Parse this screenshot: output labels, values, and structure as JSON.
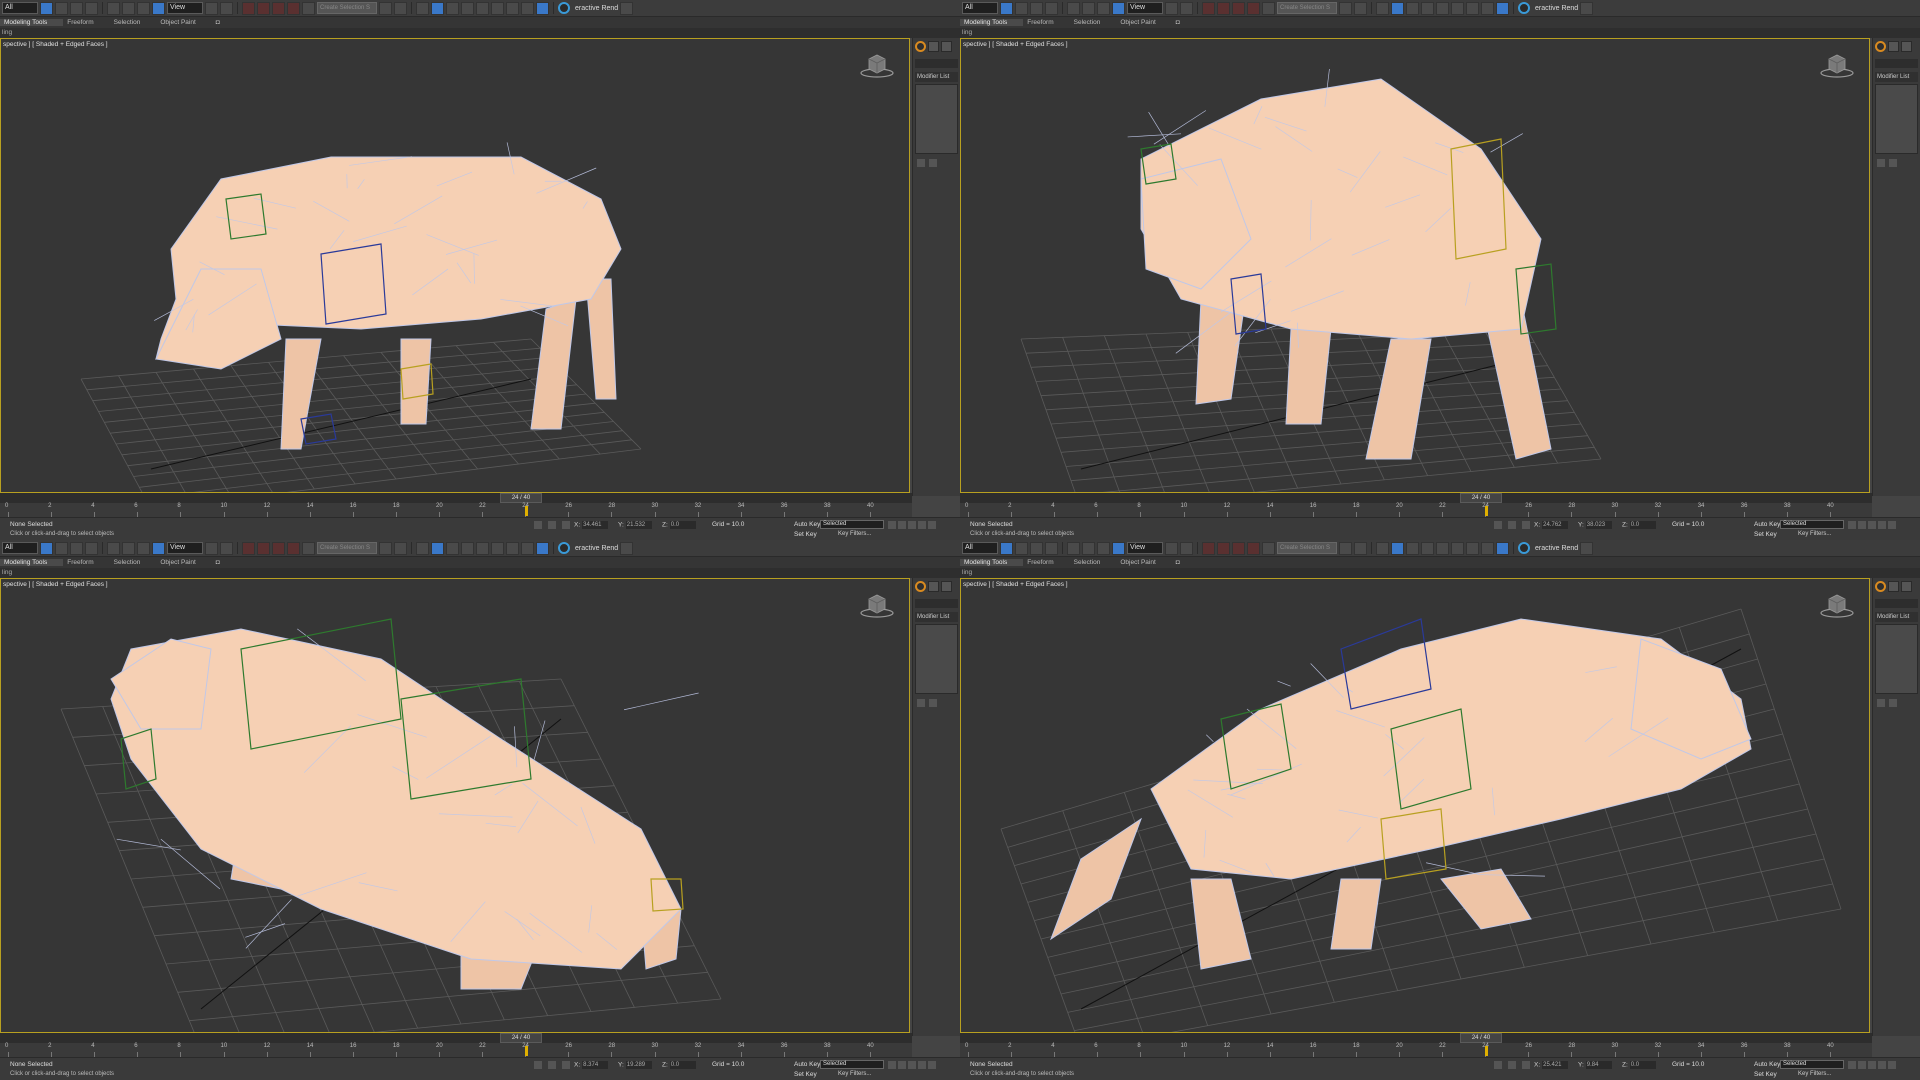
{
  "toolbar": {
    "selection_filter": "All",
    "view_dropdown": "View",
    "named_selection_placeholder": "Create Selection S",
    "render_label": "eractive Rend"
  },
  "ribbon": {
    "tabs": [
      "Modeling Tools",
      "Freeform",
      "Selection",
      "Object Paint"
    ],
    "subtitles": [
      "ling",
      "ling",
      "ling",
      "ling"
    ]
  },
  "viewport": {
    "label": "spective ] [ Shaded + Edged Faces ]"
  },
  "command_panel": {
    "modifier_list": "Modifier List"
  },
  "timeline": {
    "frame_indicator": "24 / 40",
    "ticks": [
      "0",
      "2",
      "4",
      "6",
      "8",
      "10",
      "12",
      "14",
      "16",
      "18",
      "20",
      "22",
      "24",
      "26",
      "28",
      "30",
      "32",
      "34",
      "36",
      "38",
      "40"
    ],
    "current_frame": 24,
    "total_frames": 40
  },
  "status": {
    "selection": "None Selected",
    "x_label": "X:",
    "y_label": "Y:",
    "z_label": "Z:",
    "grid": "Grid = 10.0",
    "auto_key": "Auto Key",
    "set_key": "Set Key",
    "key_mode": "Selected",
    "key_filters": "Key Filters...",
    "hint": "Click or click-and-drag to select objects"
  },
  "quadrants": [
    {
      "x": "34.461",
      "y": "21.532",
      "z": "0.0"
    },
    {
      "x": "24.762",
      "y": "38.023",
      "z": "0.0"
    },
    {
      "x": "8.374",
      "y": "19.289",
      "z": "0.0"
    },
    {
      "x": "25.421",
      "y": "9.84",
      "z": "0.0"
    }
  ],
  "colors": {
    "viewport_border": "#b8a020",
    "model_fill": "#f6d0b4",
    "wire": "#c0c8e8",
    "rig_green": "#2e7a2e",
    "rig_blue": "#2a3a9a",
    "rig_yellow": "#b8a020",
    "grid": "#5a5a5a",
    "accent_blue": "#3a78c8"
  }
}
